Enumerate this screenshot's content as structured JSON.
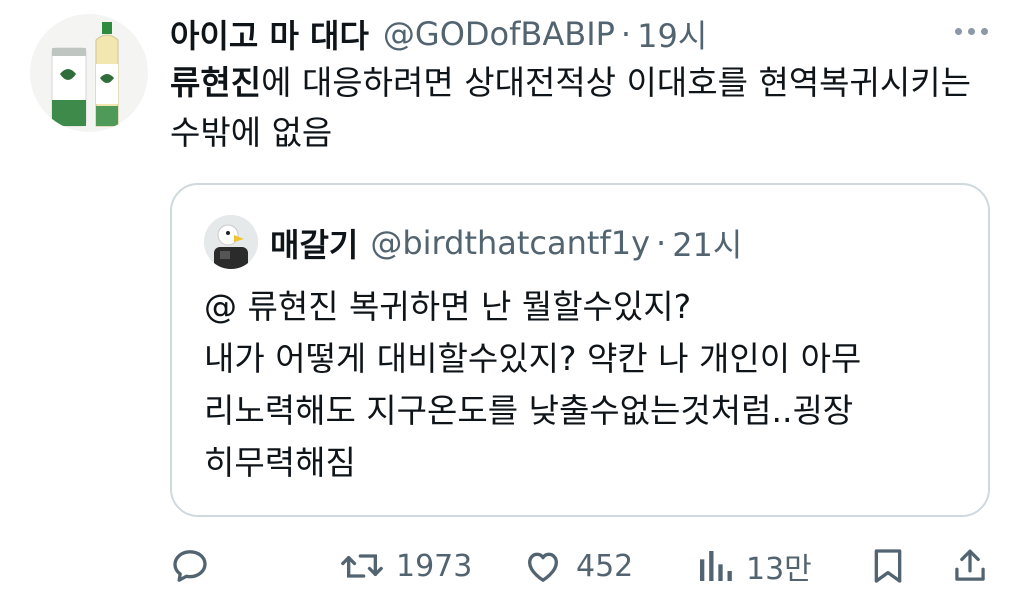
{
  "tweet": {
    "display_name": "아이고 마 대다",
    "handle": "@GODofBABIP",
    "separator": "·",
    "time": "19시",
    "text_bold": "류현진",
    "text_rest": "에 대응하려면 상대전적상 이대호를 현역복귀시키는 수밖에 없음"
  },
  "quote": {
    "display_name": "매갈기",
    "handle": "@birdthatcantf1y",
    "separator": "·",
    "time": "21시",
    "text": "@ 류현진 복귀하면 난 뭘할수있지?\n내가 어떻게 대비할수있지? 약칸  나 개인이 아무\n리노력해도  지구온도를 낮출수없는것처럼..굉장\n히무력해짐"
  },
  "actions": {
    "reply_icon": "reply-icon",
    "retweet_icon": "retweet-icon",
    "retweet_count": "1973",
    "like_icon": "heart-icon",
    "like_count": "452",
    "views_icon": "bar-chart-icon",
    "views_count": "13만",
    "bookmark_icon": "bookmark-icon",
    "share_icon": "share-icon"
  },
  "colors": {
    "text_primary": "#0f1419",
    "text_secondary": "#536471",
    "border": "#cfd9de"
  }
}
